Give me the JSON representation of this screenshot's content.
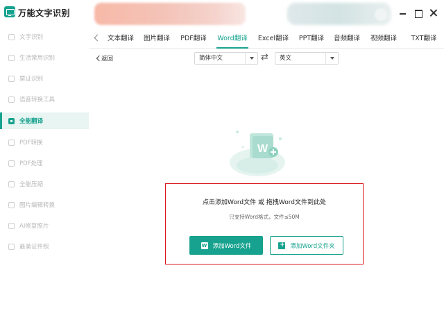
{
  "app": {
    "title": "万能文字识别"
  },
  "sidebar": {
    "items": [
      {
        "label": "文字识别",
        "icon": "text-scan-icon"
      },
      {
        "label": "生活常用识别",
        "icon": "life-scan-icon"
      },
      {
        "label": "票证识别",
        "icon": "ticket-scan-icon"
      },
      {
        "label": "语音转换工具",
        "icon": "voice-convert-icon"
      },
      {
        "label": "全能翻译",
        "icon": "translate-icon",
        "active": true
      },
      {
        "label": "PDF转换",
        "icon": "pdf-convert-icon"
      },
      {
        "label": "PDF处理",
        "icon": "pdf-process-icon"
      },
      {
        "label": "全能压缩",
        "icon": "compress-icon"
      },
      {
        "label": "图片编辑转换",
        "icon": "image-edit-icon"
      },
      {
        "label": "AI修复照片",
        "icon": "ai-photo-icon"
      },
      {
        "label": "最美证件照",
        "icon": "id-photo-icon"
      }
    ]
  },
  "tabs": [
    {
      "label": "文本翻译"
    },
    {
      "label": "图片翻译"
    },
    {
      "label": "PDF翻译"
    },
    {
      "label": "Word翻译",
      "active": true
    },
    {
      "label": "Excel翻译"
    },
    {
      "label": "PPT翻译"
    },
    {
      "label": "音频翻译"
    },
    {
      "label": "视频翻译"
    },
    {
      "label": "TXT翻译"
    }
  ],
  "toolbar": {
    "back_label": "返回",
    "source_language": "简体中文",
    "target_language": "英文"
  },
  "dropzone": {
    "main_text": "点击添加Word文件 或 拖拽Word文件到此处",
    "sub_text": "只支持Word格式，文件≤50M",
    "add_file_label": "添加Word文件",
    "add_folder_label": "添加Word文件夹"
  },
  "colors": {
    "accent": "#16a28e",
    "highlight_border": "#d9161a"
  }
}
